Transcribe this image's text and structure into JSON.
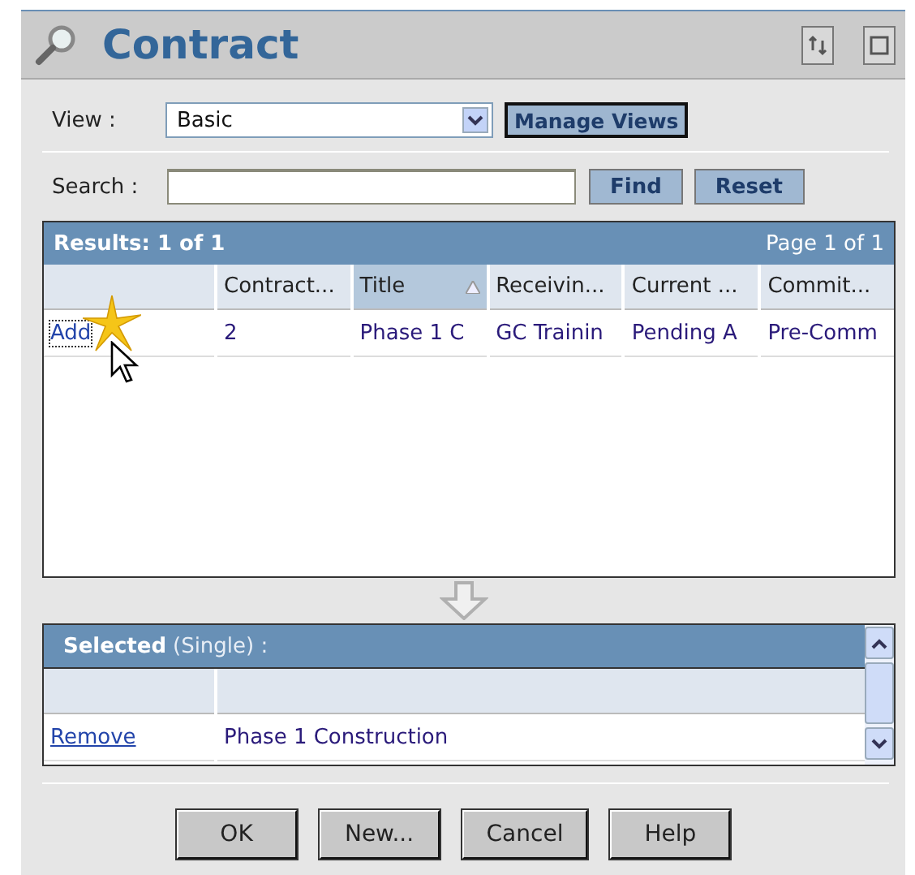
{
  "window": {
    "title": "Contract"
  },
  "view": {
    "label": "View :",
    "value": "Basic",
    "manage_button": "Manage Views"
  },
  "search": {
    "label": "Search :",
    "buttons": [
      "Find",
      "Reset"
    ]
  },
  "results": {
    "title": "Results: 1 of 1",
    "page": "Page 1 of 1",
    "columns": [
      {
        "label": "Contract...",
        "sorted": false
      },
      {
        "label": "Title",
        "sorted": true
      },
      {
        "label": "Receivin...",
        "sorted": false
      },
      {
        "label": "Current ...",
        "sorted": false
      },
      {
        "label": "Commit...",
        "sorted": false
      }
    ],
    "rows": [
      {
        "action": "Add",
        "cells": [
          "2",
          "Phase 1 C",
          "GC Trainin",
          "Pending A",
          "Pre-Comm"
        ]
      }
    ]
  },
  "selected": {
    "title": "Selected",
    "mode": "(Single) :",
    "rows": [
      {
        "action": "Remove",
        "value": "Phase 1 Construction"
      }
    ]
  },
  "buttons": [
    "OK",
    "New...",
    "Cancel",
    "Help"
  ]
}
